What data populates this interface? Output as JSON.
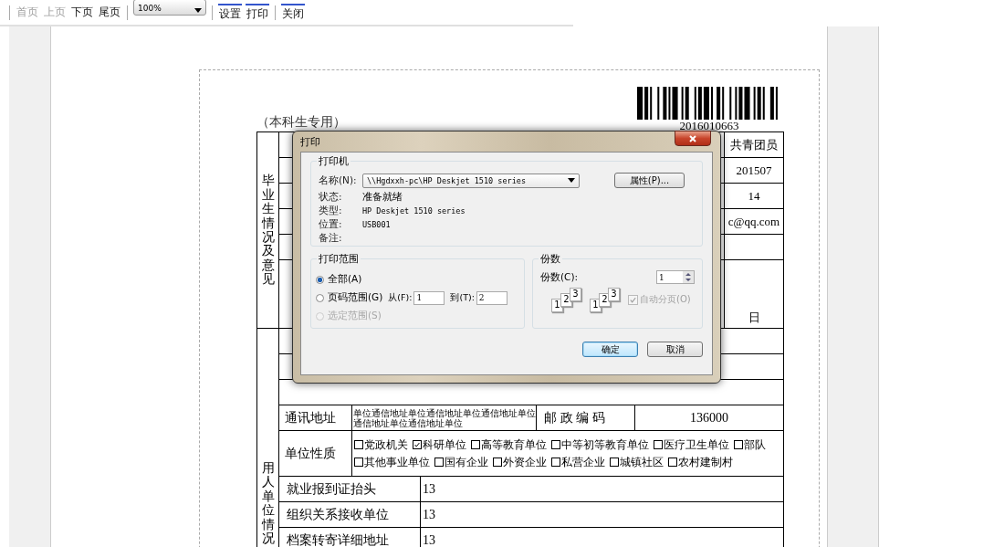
{
  "toolbar": {
    "nav": [
      {
        "label": "首页",
        "disabled": true
      },
      {
        "label": "上页",
        "disabled": true
      },
      {
        "label": "下页",
        "disabled": false
      },
      {
        "label": "尾页",
        "disabled": false
      }
    ],
    "zoom": "100%",
    "actions": [
      "设置",
      "打印",
      "关闭"
    ]
  },
  "document": {
    "barcode_number": "2016010663",
    "subtitle": "（本科生专用）",
    "graduate_section": {
      "label": "毕业生情况及意见",
      "rows": [
        {
          "kind": "value",
          "value": "共青团员"
        },
        {
          "kind": "value",
          "value": "201507"
        },
        {
          "kind": "value",
          "value": "14"
        },
        {
          "kind": "value",
          "value": "c@qq.com"
        },
        {
          "kind": "blank"
        },
        {
          "kind": "date",
          "value": "日"
        }
      ]
    },
    "employer_section": {
      "label": "用人单位情况",
      "address": {
        "label": "通讯地址",
        "value": "单位通信地址单位通信地址单位通信地址单位通信地址单位通信地址单位",
        "postcode_label": "邮 政 编 码",
        "postcode": "136000"
      },
      "nature": {
        "label": "单位性质",
        "options": [
          {
            "label": "党政机关",
            "checked": false
          },
          {
            "label": "科研单位",
            "checked": true
          },
          {
            "label": "高等教育单位",
            "checked": false
          },
          {
            "label": "中等初等教育单位",
            "checked": false
          },
          {
            "label": "医疗卫生单位",
            "checked": false
          },
          {
            "label": "部队",
            "checked": false
          },
          {
            "label": "其他事业单位",
            "checked": false
          },
          {
            "label": "国有企业",
            "checked": false
          },
          {
            "label": "外资企业",
            "checked": false
          },
          {
            "label": "私营企业",
            "checked": false
          },
          {
            "label": "城镇社区",
            "checked": false
          },
          {
            "label": "农村建制村",
            "checked": false
          }
        ]
      },
      "fields": [
        {
          "label": "就业报到证抬头",
          "value": "13"
        },
        {
          "label": "组织关系接收单位",
          "value": "13"
        },
        {
          "label": "档案转寄详细地址",
          "value": "13"
        }
      ]
    }
  },
  "dialog": {
    "title": "打印",
    "printer": {
      "title": "打印机",
      "name_label": "名称(N):",
      "name": "\\\\Hgdxxh-pc\\HP Deskjet 1510 series",
      "properties": "属性(P)...",
      "info": [
        {
          "label": "状态:",
          "value": "准备就绪"
        },
        {
          "label": "类型:",
          "value": "HP Deskjet 1510 series"
        },
        {
          "label": "位置:",
          "value": "USB001"
        },
        {
          "label": "备注:"
        }
      ]
    },
    "range": {
      "title": "打印范围",
      "options": [
        {
          "label": "全部(A)",
          "selected": true,
          "disabled": false
        },
        {
          "label": "页码范围(G)",
          "selected": false,
          "disabled": false
        },
        {
          "label": "选定范围(S)",
          "selected": false,
          "disabled": true
        }
      ],
      "from_label": "从(F):",
      "from": "1",
      "to_label": "到(T):",
      "to": "2"
    },
    "copies": {
      "title": "份数",
      "label": "份数(C):",
      "value": "1",
      "collate_icons": [
        [
          "1",
          "2",
          "3"
        ],
        [
          "1",
          "2",
          "3"
        ]
      ],
      "collate": {
        "label": "自动分页(O)",
        "checked": true,
        "disabled": true
      }
    },
    "buttons": [
      {
        "label": "确定",
        "default": true
      },
      {
        "label": "取消",
        "default": false
      }
    ]
  }
}
